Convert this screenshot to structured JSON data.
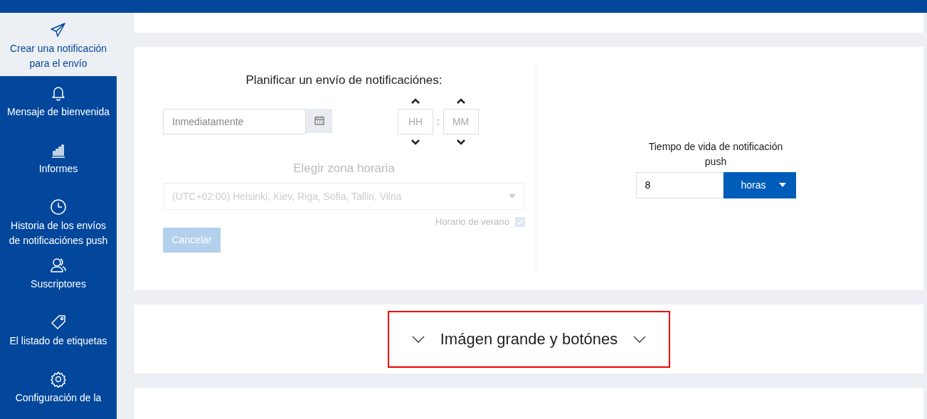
{
  "sidebar": {
    "items": [
      {
        "label": "Crear una notificación para el envío",
        "selected": true
      },
      {
        "label": "Mensaje de bienvenida",
        "selected": false
      },
      {
        "label": "Informes",
        "selected": false
      },
      {
        "label": "Historia de los envíos de notificaciónes push",
        "selected": false
      },
      {
        "label": "Suscriptores",
        "selected": false
      },
      {
        "label": "El listado de etiquetas",
        "selected": false
      },
      {
        "label": "Configuración de la",
        "selected": false
      }
    ]
  },
  "schedule": {
    "title": "Planificar un envío de notificaciónes:",
    "date_placeholder": "Inmediatamente",
    "hour_placeholder": "HH",
    "separator": ":",
    "minute_placeholder": "MM",
    "timezone_label": "Elegir zona horaria",
    "timezone": "(UTC+02:00) Helsinki, Kiev, Riga, Sofia, Tallin, Vilna",
    "timezone_disabled": true,
    "daylight_label": "Horario de verano",
    "daylight_checked": true,
    "cancel_label": "Cancelar",
    "cancel_disabled": true
  },
  "lifetime": {
    "label": "Tiempo de vida de notificación push",
    "value": "8",
    "unit": "horas"
  },
  "section": {
    "title": "Imágen grande y botónes",
    "highlighted": true
  }
}
